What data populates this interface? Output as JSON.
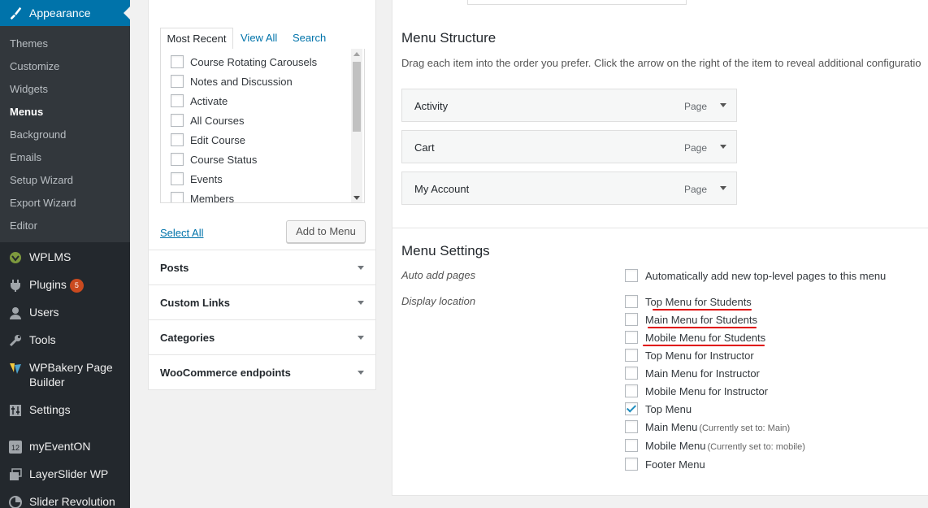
{
  "sidebar": {
    "current_section": "Appearance",
    "submenu": [
      "Themes",
      "Customize",
      "Widgets",
      "Menus",
      "Background",
      "Emails",
      "Setup Wizard",
      "Export Wizard",
      "Editor"
    ],
    "current_submenu": "Menus",
    "items": [
      {
        "label": "WPLMS",
        "icon": "wplms-icon"
      },
      {
        "label": "Plugins",
        "icon": "plugins-icon",
        "badge": "5"
      },
      {
        "label": "Users",
        "icon": "users-icon"
      },
      {
        "label": "Tools",
        "icon": "tools-icon"
      },
      {
        "label": "WPBakery Page Builder",
        "icon": "wpbakery-icon"
      },
      {
        "label": "Settings",
        "icon": "settings-icon"
      },
      {
        "label": "myEventON",
        "icon": "calendar-icon"
      },
      {
        "label": "LayerSlider WP",
        "icon": "layerslider-icon"
      },
      {
        "label": "Slider Revolution",
        "icon": "slider-revolution-icon"
      }
    ]
  },
  "pages_box": {
    "tabs": [
      "Most Recent",
      "View All",
      "Search"
    ],
    "items": [
      "Course Rotating Carousels",
      "Notes and Discussion",
      "Activate",
      "All Courses",
      "Edit Course",
      "Course Status",
      "Events",
      "Members"
    ],
    "select_all": "Select All",
    "add_button": "Add to Menu"
  },
  "accordion": [
    "Posts",
    "Custom Links",
    "Categories",
    "WooCommerce endpoints"
  ],
  "structure": {
    "title": "Menu Structure",
    "description": "Drag each item into the order you prefer. Click the arrow on the right of the item to reveal additional configuratio",
    "items": [
      {
        "title": "Activity",
        "type": "Page"
      },
      {
        "title": "Cart",
        "type": "Page"
      },
      {
        "title": "My Account",
        "type": "Page"
      }
    ]
  },
  "settings": {
    "title": "Menu Settings",
    "auto_add_label": "Auto add pages",
    "auto_add_option": "Automatically add new top-level pages to this menu",
    "display_location_label": "Display location",
    "locations": [
      {
        "label": "Top Menu for Students",
        "checked": false,
        "note": ""
      },
      {
        "label": "Main Menu for Students",
        "checked": false,
        "note": ""
      },
      {
        "label": "Mobile Menu for Students",
        "checked": false,
        "note": ""
      },
      {
        "label": "Top Menu for Instructor",
        "checked": false,
        "note": ""
      },
      {
        "label": "Main Menu for Instructor",
        "checked": false,
        "note": ""
      },
      {
        "label": "Mobile Menu for Instructor",
        "checked": false,
        "note": ""
      },
      {
        "label": "Top Menu",
        "checked": true,
        "note": ""
      },
      {
        "label": "Main Menu",
        "checked": false,
        "note": "(Currently set to: Main)"
      },
      {
        "label": "Mobile Menu",
        "checked": false,
        "note": "(Currently set to: mobile)"
      },
      {
        "label": "Footer Menu",
        "checked": false,
        "note": ""
      }
    ]
  },
  "colors": {
    "sidebar_bg": "#23282d",
    "submenu_bg": "#32373c",
    "accent": "#0073aa",
    "badge": "#ca4a1f",
    "annotation": "#e00000"
  }
}
